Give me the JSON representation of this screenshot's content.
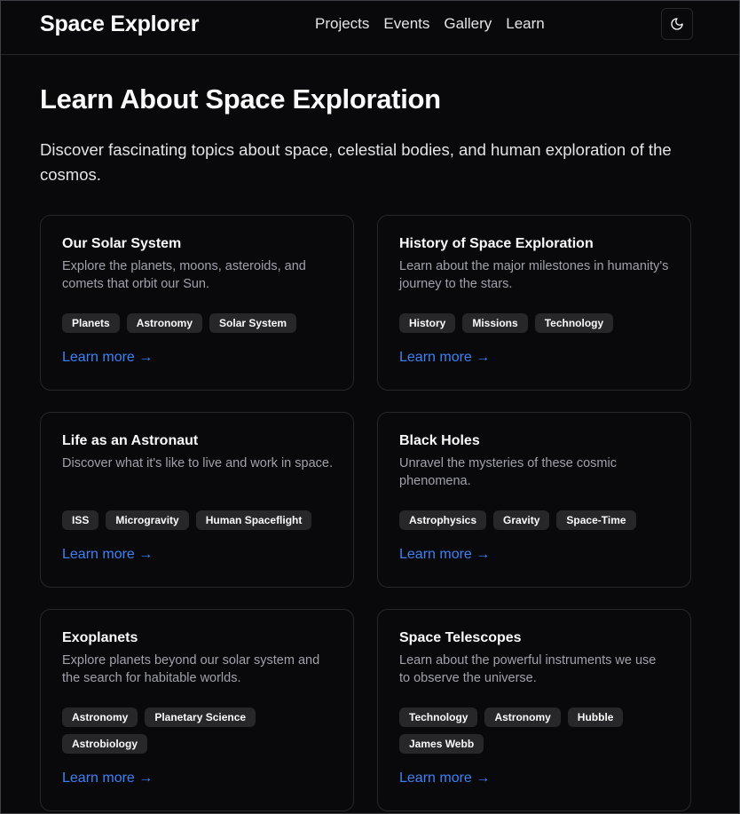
{
  "nav": {
    "brand": "Space Explorer",
    "links": [
      "Projects",
      "Events",
      "Gallery",
      "Learn"
    ],
    "theme_icon": "moon-icon"
  },
  "page": {
    "title": "Learn About Space Exploration",
    "intro": "Discover fascinating topics about space, celestial bodies, and human exploration of the cosmos."
  },
  "cards": [
    {
      "title": "Our Solar System",
      "description": "Explore the planets, moons, asteroids, and comets that orbit our Sun.",
      "tags": [
        "Planets",
        "Astronomy",
        "Solar System"
      ],
      "link": "Learn more →"
    },
    {
      "title": "History of Space Exploration",
      "description": "Learn about the major milestones in humanity's journey to the stars.",
      "tags": [
        "History",
        "Missions",
        "Technology"
      ],
      "link": "Learn more →"
    },
    {
      "title": "Life as an Astronaut",
      "description": "Discover what it's like to live and work in space.",
      "tags": [
        "ISS",
        "Microgravity",
        "Human Spaceflight"
      ],
      "link": "Learn more →"
    },
    {
      "title": "Black Holes",
      "description": "Unravel the mysteries of these cosmic phenomena.",
      "tags": [
        "Astrophysics",
        "Gravity",
        "Space-Time"
      ],
      "link": "Learn more →"
    },
    {
      "title": "Exoplanets",
      "description": "Explore planets beyond our solar system and the search for habitable worlds.",
      "tags": [
        "Astronomy",
        "Planetary Science",
        "Astrobiology"
      ],
      "link": "Learn more →"
    },
    {
      "title": "Space Telescopes",
      "description": "Learn about the powerful instruments we use to observe the universe.",
      "tags": [
        "Technology",
        "Astronomy",
        "Hubble",
        "James Webb"
      ],
      "link": "Learn more →"
    }
  ],
  "colors": {
    "background": "#09090b",
    "border": "#27272a",
    "muted_text": "#a1a1aa",
    "tag_bg": "#27272a",
    "link": "#3b82f6"
  }
}
